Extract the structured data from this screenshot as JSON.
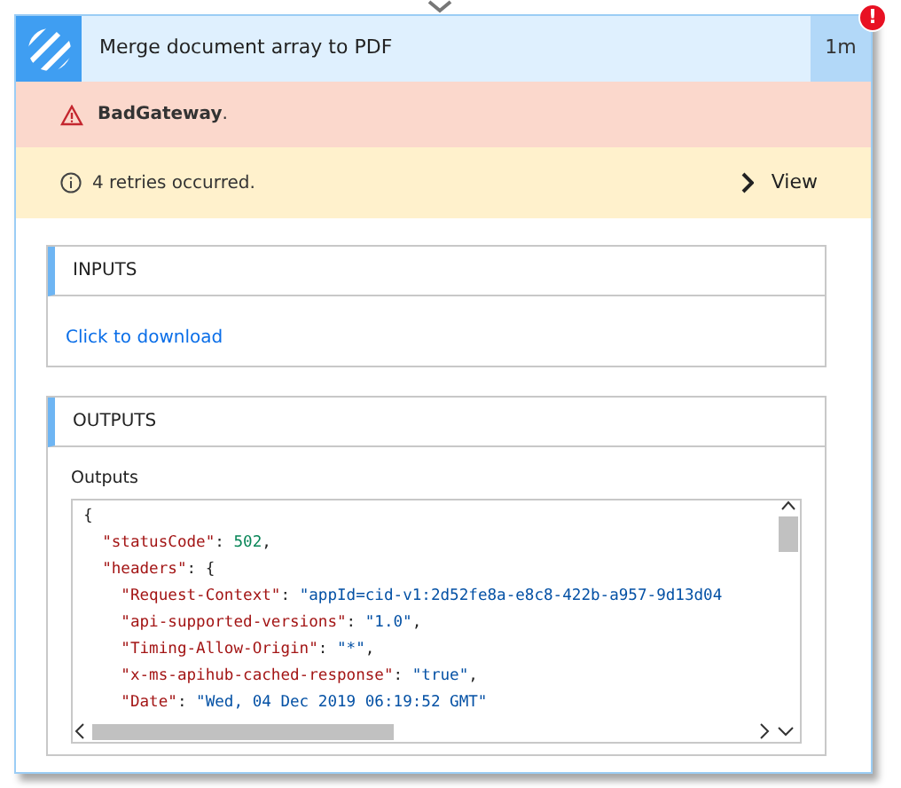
{
  "action": {
    "title": "Merge document array to PDF",
    "duration": "1m",
    "error_badge": "!"
  },
  "error": {
    "message": "BadGateway",
    "suffix": "."
  },
  "retries": {
    "message": "4 retries occurred.",
    "link": "View"
  },
  "inputs": {
    "heading": "INPUTS",
    "link": "Click to download"
  },
  "outputs": {
    "heading": "OUTPUTS",
    "label": "Outputs",
    "code": [
      [
        {
          "kind": "plain",
          "text": "{"
        }
      ],
      [
        {
          "kind": "key",
          "text": "\"statusCode\""
        },
        {
          "kind": "plain",
          "text": ": "
        },
        {
          "kind": "number",
          "text": "502"
        },
        {
          "kind": "plain",
          "text": ","
        }
      ],
      [
        {
          "kind": "key",
          "text": "\"headers\""
        },
        {
          "kind": "plain",
          "text": ": {"
        }
      ],
      [
        {
          "kind": "key",
          "text": "\"Request-Context\""
        },
        {
          "kind": "plain",
          "text": ": "
        },
        {
          "kind": "string",
          "text": "\"appId=cid-v1:2d52fe8a-e8c8-422b-a957-9d13d04"
        }
      ],
      [
        {
          "kind": "key",
          "text": "\"api-supported-versions\""
        },
        {
          "kind": "plain",
          "text": ": "
        },
        {
          "kind": "string",
          "text": "\"1.0\""
        },
        {
          "kind": "plain",
          "text": ","
        }
      ],
      [
        {
          "kind": "key",
          "text": "\"Timing-Allow-Origin\""
        },
        {
          "kind": "plain",
          "text": ": "
        },
        {
          "kind": "string",
          "text": "\"*\""
        },
        {
          "kind": "plain",
          "text": ","
        }
      ],
      [
        {
          "kind": "key",
          "text": "\"x-ms-apihub-cached-response\""
        },
        {
          "kind": "plain",
          "text": ": "
        },
        {
          "kind": "string",
          "text": "\"true\""
        },
        {
          "kind": "plain",
          "text": ","
        }
      ],
      [
        {
          "kind": "key",
          "text": "\"Date\""
        },
        {
          "kind": "plain",
          "text": ": "
        },
        {
          "kind": "string",
          "text": "\"Wed, 04 Dec 2019 06:19:52 GMT\""
        }
      ]
    ]
  }
}
